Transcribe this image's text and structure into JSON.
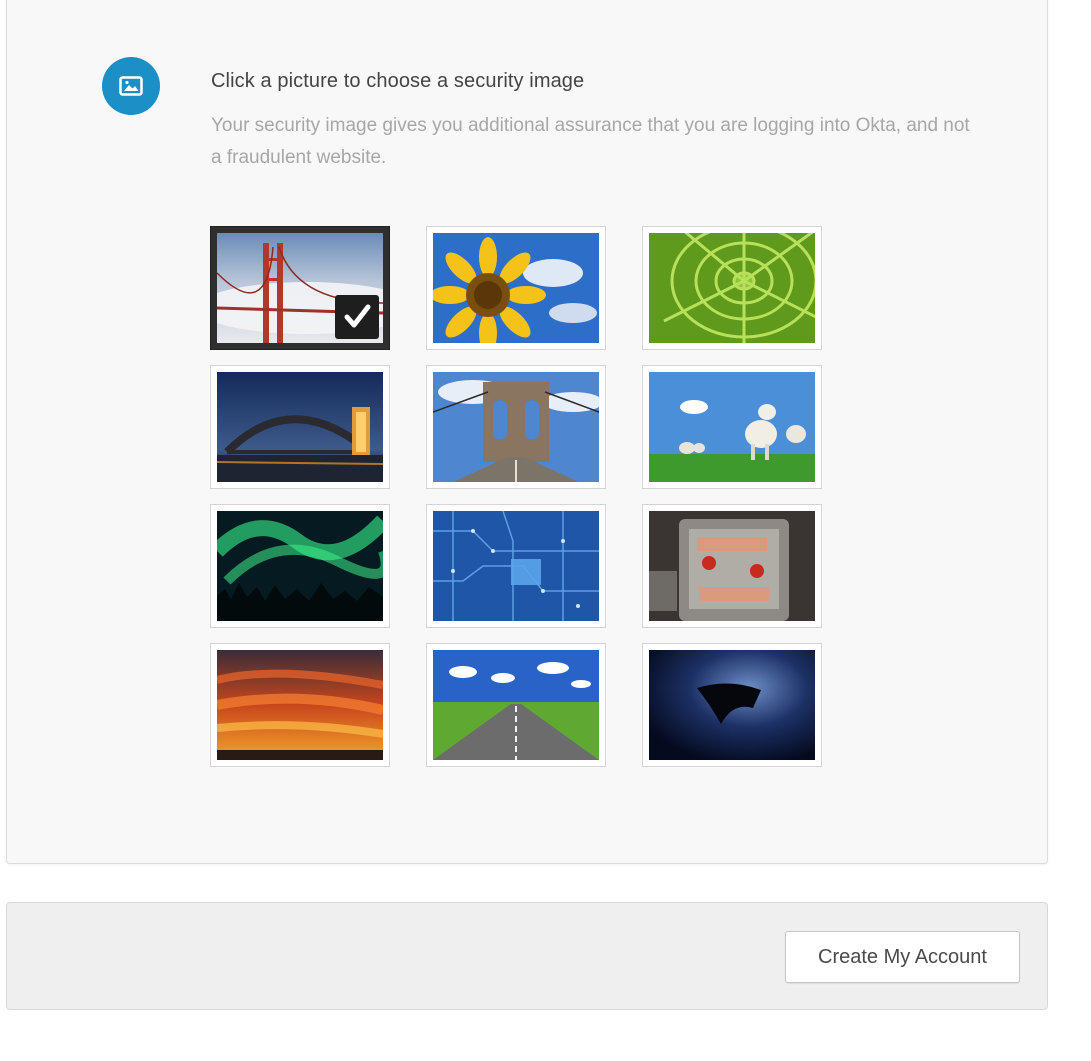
{
  "security_image": {
    "icon": "picture-icon",
    "title": "Click a picture to choose a security image",
    "description": "Your security image gives you additional assurance that you are logging into Okta, and not a fraudulent website.",
    "selected_index": 0,
    "images": [
      {
        "name": "golden-gate-bridge"
      },
      {
        "name": "sunflower"
      },
      {
        "name": "succulent"
      },
      {
        "name": "harbour-bridge-night"
      },
      {
        "name": "brooklyn-bridge"
      },
      {
        "name": "lambs"
      },
      {
        "name": "aurora"
      },
      {
        "name": "circuit-board"
      },
      {
        "name": "toy-robot"
      },
      {
        "name": "sunset-clouds"
      },
      {
        "name": "road"
      },
      {
        "name": "manta-ray"
      }
    ]
  },
  "footer": {
    "create_account_label": "Create My Account"
  },
  "colors": {
    "accent": "#1b8fc6",
    "panel_bg": "#f8f8f8",
    "muted_text": "#a7a7a7"
  }
}
